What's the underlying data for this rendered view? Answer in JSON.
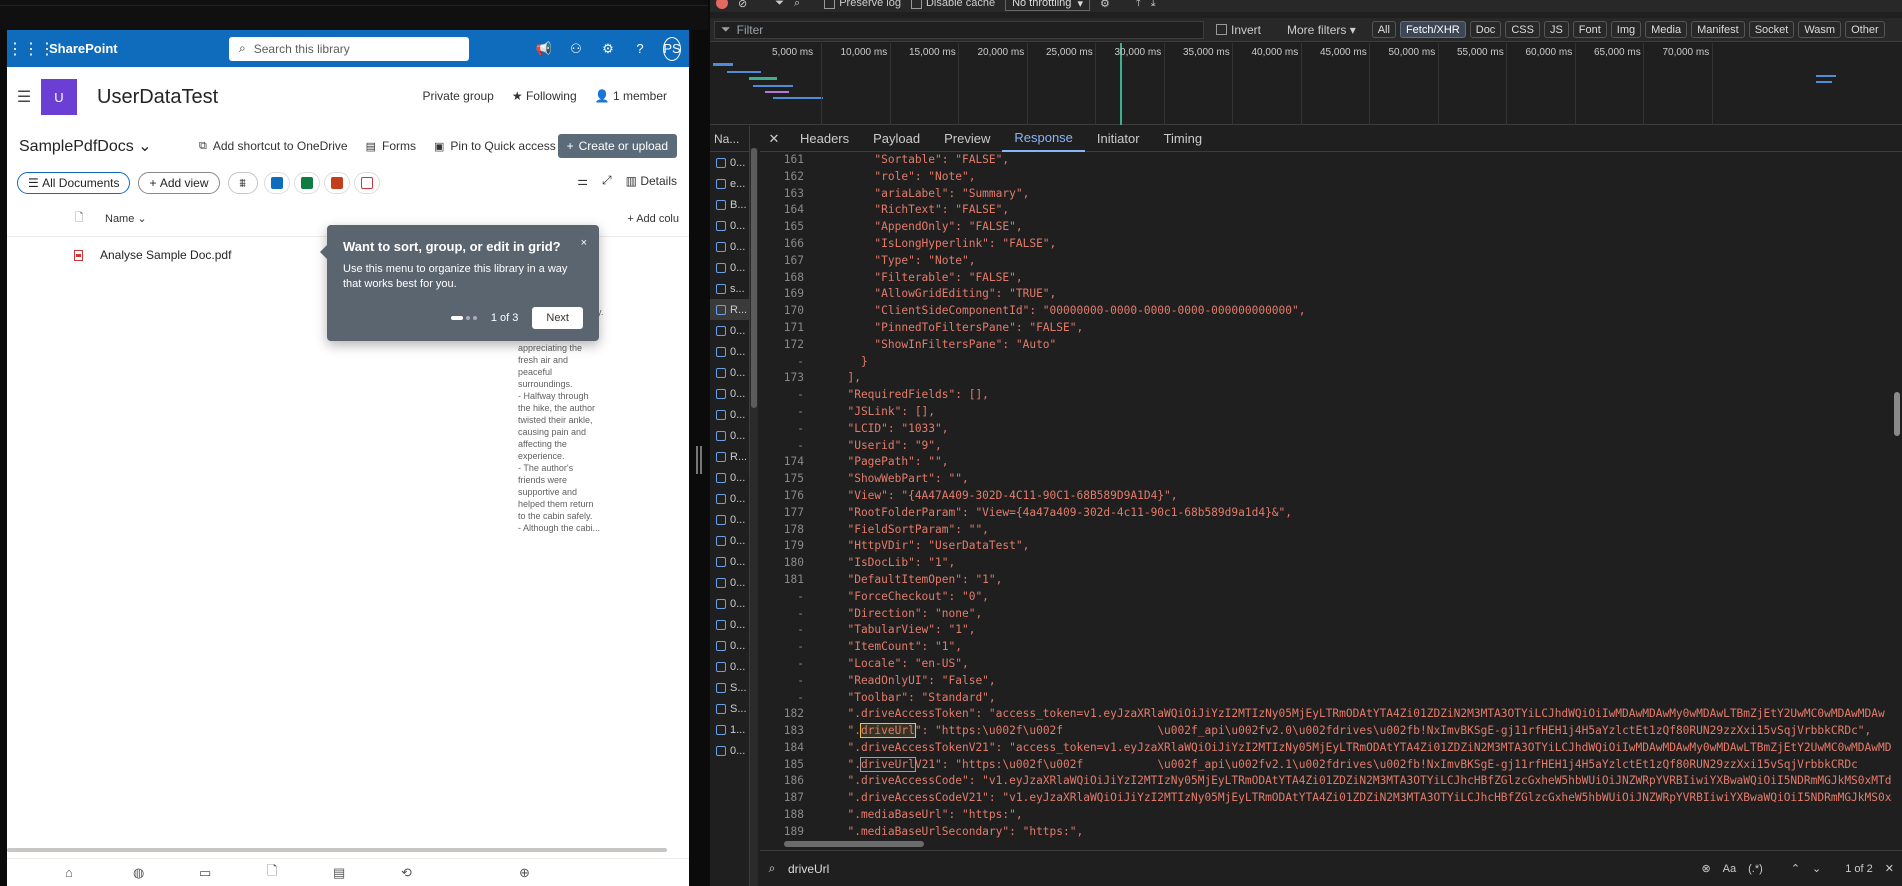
{
  "sharepoint": {
    "brand": "SharePoint",
    "search_placeholder": "Search this library",
    "avatar_initials": "PS",
    "site_logo_letter": "U",
    "site_title": "UserDataTest",
    "site_privacy": "Private group",
    "following": "Following",
    "members": "1 member",
    "library_name": "SamplePdfDocs",
    "commands": [
      "Add shortcut to OneDrive",
      "Forms",
      "Pin to Quick access"
    ],
    "more": "···",
    "create_upload": "Create or upload",
    "view_all": "All Documents",
    "add_view": "Add view",
    "details": "Details",
    "col_name": "Name",
    "col_add": "Add colu",
    "file_name": "Analyse Sample Doc.pdf",
    "cut_letter": "J",
    "summary_text": "breathtaking scenery.\n- They hiked for\nseveral hours,\nappreciating the\nfresh air and\npeaceful\nsurroundings.\n- Halfway through\nthe hike, the author\ntwisted their ankle,\ncausing pain and\naffecting the\nexperience.\n- The author's\nfriends were\nsupportive and\nhelped them return\nto the cabin safely.\n- Although the cabi...",
    "tip": {
      "title": "Want to sort, group, or edit in grid?",
      "body": "Use this menu to organize this library in a way that works best for you.",
      "progress": "1 of 3",
      "next": "Next",
      "close": "×"
    }
  },
  "devtools": {
    "toolbar": {
      "preserve_log": "Preserve log",
      "disable_cache": "Disable cache",
      "throttling": "No throttling"
    },
    "filter_placeholder": "Filter",
    "invert": "Invert",
    "more_filters": "More filters",
    "type_chips": [
      "All",
      "Fetch/XHR",
      "Doc",
      "CSS",
      "JS",
      "Font",
      "Img",
      "Media",
      "Manifest",
      "Socket",
      "Wasm",
      "Other"
    ],
    "selected_chip": "Fetch/XHR",
    "timeline_ticks": [
      "5,000 ms",
      "10,000 ms",
      "15,000 ms",
      "20,000 ms",
      "25,000 ms",
      "30,000 ms",
      "35,000 ms",
      "40,000 ms",
      "45,000 ms",
      "50,000 ms",
      "55,000 ms",
      "60,000 ms",
      "65,000 ms",
      "70,000 ms"
    ],
    "list_header": "Na...",
    "list_items": [
      "0...",
      "e...",
      "B...",
      "0...",
      "0...",
      "0...",
      "s...",
      "R...",
      "0...",
      "0...",
      "0...",
      "0...",
      "0...",
      "0...",
      "R...",
      "0...",
      "0...",
      "0...",
      "0...",
      "0...",
      "0...",
      "0...",
      "0...",
      "0...",
      "0...",
      "S...",
      "S...",
      "1...",
      "0..."
    ],
    "tabs": [
      "Headers",
      "Payload",
      "Preview",
      "Response",
      "Initiator",
      "Timing"
    ],
    "active_tab": "Response",
    "lines": [
      {
        "n": "161",
        "t": "      \"Sortable\": \"FALSE\","
      },
      {
        "n": "162",
        "t": "      \"role\": \"Note\","
      },
      {
        "n": "163",
        "t": "      \"ariaLabel\": \"Summary\","
      },
      {
        "n": "164",
        "t": "      \"RichText\": \"FALSE\","
      },
      {
        "n": "165",
        "t": "      \"AppendOnly\": \"FALSE\","
      },
      {
        "n": "166",
        "t": "      \"IsLongHyperlink\": \"FALSE\","
      },
      {
        "n": "167",
        "t": "      \"Type\": \"Note\","
      },
      {
        "n": "168",
        "t": "      \"Filterable\": \"FALSE\","
      },
      {
        "n": "169",
        "t": "      \"AllowGridEditing\": \"TRUE\","
      },
      {
        "n": "170",
        "t": "      \"ClientSideComponentId\": \"00000000-0000-0000-0000-000000000000\","
      },
      {
        "n": "171",
        "t": "      \"PinnedToFiltersPane\": \"FALSE\","
      },
      {
        "n": "172",
        "t": "      \"ShowInFiltersPane\": \"Auto\""
      },
      {
        "n": "-",
        "t": "    }"
      },
      {
        "n": "173",
        "t": "  ],"
      },
      {
        "n": "-",
        "t": "  \"RequiredFields\": [],"
      },
      {
        "n": "-",
        "t": "  \"JSLink\": [],"
      },
      {
        "n": "-",
        "t": "  \"LCID\": \"1033\","
      },
      {
        "n": "-",
        "t": "  \"Userid\": \"9\","
      },
      {
        "n": "174",
        "t": "  \"PagePath\": \"\","
      },
      {
        "n": "175",
        "t": "  \"ShowWebPart\": \"\","
      },
      {
        "n": "176",
        "t": "  \"View\": \"{4A47A409-302D-4C11-90C1-68B589D9A1D4}\","
      },
      {
        "n": "177",
        "t": "  \"RootFolderParam\": \"View={4a47a409-302d-4c11-90c1-68b589d9a1d4}&\","
      },
      {
        "n": "178",
        "t": "  \"FieldSortParam\": \"\","
      },
      {
        "n": "179",
        "t": "  \"HttpVDir\": \"UserDataTest\","
      },
      {
        "n": "180",
        "t": "  \"IsDocLib\": \"1\","
      },
      {
        "n": "181",
        "t": "  \"DefaultItemOpen\": \"1\","
      },
      {
        "n": "-",
        "t": "  \"ForceCheckout\": \"0\","
      },
      {
        "n": "-",
        "t": "  \"Direction\": \"none\","
      },
      {
        "n": "-",
        "t": "  \"TabularView\": \"1\","
      },
      {
        "n": "-",
        "t": "  \"ItemCount\": \"1\","
      },
      {
        "n": "-",
        "t": "  \"Locale\": \"en-US\","
      },
      {
        "n": "-",
        "t": "  \"ReadOnlyUI\": \"False\","
      },
      {
        "n": "-",
        "t": "  \"Toolbar\": \"Standard\","
      },
      {
        "n": "182",
        "t": "  \".driveAccessToken\": \"access_token=v1.eyJzaXRlaWQiOiJiYzI2MTIzNy05MjEyLTRmODAtYTA4Zi01ZDZiN2M3MTA3OTYiLCJhdWQiOiIwMDAwMDAwMy0wMDAwLTBmZjEtY2UwMC0wMDAwMDAw"
      },
      {
        "n": "183",
        "t": "  \".driveUrl\": \"https:\\u002f\\u002f              \\u002f_api\\u002fv2.0\\u002fdrives\\u002fb!NxImvBKSgE-gj11rfHEH1j4H5aYzlctEt1zQf80RUN29zzXxi15vSqjVrbbkCRDc\","
      },
      {
        "n": "184",
        "t": "  \".driveAccessTokenV21\": \"access_token=v1.eyJzaXRlaWQiOiJiYzI2MTIzNy05MjEyLTRmODAtYTA4Zi01ZDZiN2M3MTA3OTYiLCJhdWQiOiIwMDAwMDAwMy0wMDAwLTBmZjEtY2UwMC0wMDAwMDAwM"
      },
      {
        "n": "185",
        "t": "  \".driveUrlV21\": \"https:\\u002f\\u002f           \\u002f_api\\u002fv2.1\\u002fdrives\\u002fb!NxImvBKSgE-gj11rfHEH1j4H5aYzlctEt1zQf80RUN29zzXxi15vSqjVrbbkCRDc"
      },
      {
        "n": "186",
        "t": "  \".driveAccessCode\": \"v1.eyJzaXRlaWQiOiJiYzI2MTIzNy05MjEyLTRmODAtYTA4Zi01ZDZiN2M3MTA3OTYiLCJhcHBfZGlzcGxheW5hbWUiOiJNZWRpYVRBIiwiYXBwaWQiOiI5NDRmMGJkMS0xMTdiLT"
      },
      {
        "n": "187",
        "t": "  \".driveAccessCodeV21\": \"v1.eyJzaXRlaWQiOiJiYzI2MTIzNy05MjEyLTRmODAtYTA4Zi01ZDZiN2M3MTA3OTYiLCJhcHBfZGlzcGxheW5hbWUiOiJNZWRpYVRBIiwiYXBwaWQiOiI5NDRmMGJkMS0xMTd"
      },
      {
        "n": "188",
        "t": "  \".mediaBaseUrl\": \"https:\","
      },
      {
        "n": "189",
        "t": "  \".mediaBaseUrlSecondary\": \"https:\","
      }
    ],
    "search_query": "driveUrl",
    "search_count": "1 of 2",
    "search_aa": "Aa",
    "search_regex": "(.*)"
  }
}
